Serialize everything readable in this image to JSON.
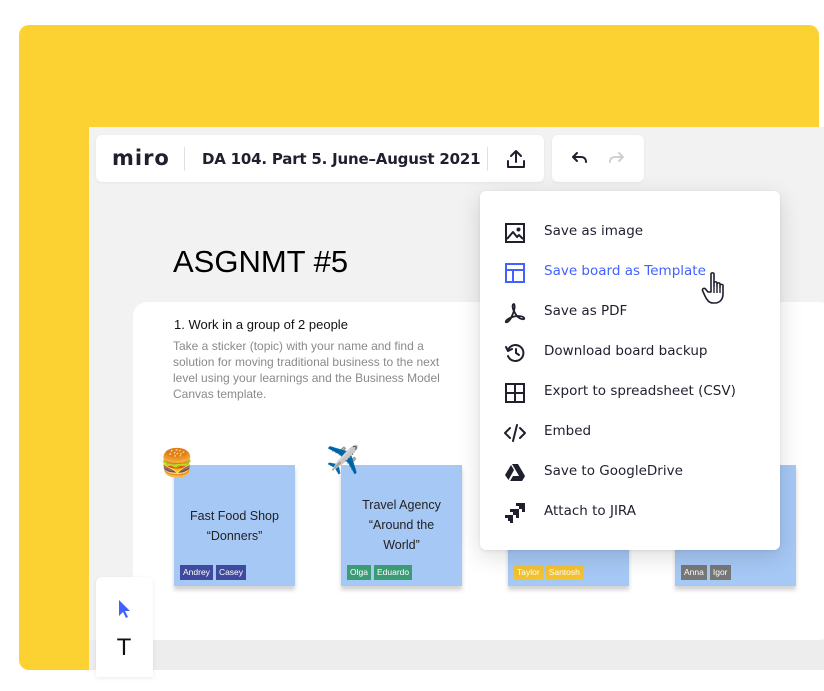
{
  "colors": {
    "background_accent": "#FCD232",
    "active_item": "#4262FF",
    "sticky": "#A6C8F5"
  },
  "toolbar": {
    "logo": "miro",
    "board_title": "DA 104. Part 5. June–August 2021",
    "export_icon": "upload-icon",
    "undo_icon": "undo-icon",
    "redo_icon": "redo-icon"
  },
  "board": {
    "heading": "ASGNMT #5",
    "task_title": "1. Work in a group of 2 people",
    "task_description": "Take a sticker (topic) with your name and find a solution for moving traditional business to the next level using your learnings and the Business Model Canvas template."
  },
  "stickies": [
    {
      "line1": "Fast Food Shop",
      "line2": "“Donners”",
      "line3": "",
      "tags": [
        {
          "name": "Andrey",
          "color": "#3F4A9E"
        },
        {
          "name": "Casey",
          "color": "#3F4A9E"
        }
      ],
      "emoji": "🍔"
    },
    {
      "line1": "Travel Agency",
      "line2": "“Around the",
      "line3": "World”",
      "tags": [
        {
          "name": "Olga",
          "color": "#3B9B74"
        },
        {
          "name": "Eduardo",
          "color": "#3B9B74"
        }
      ],
      "emoji": "✈️"
    },
    {
      "line1": "",
      "line2": "",
      "line3": "",
      "tags": [
        {
          "name": "Taylor",
          "color": "#F2C230"
        },
        {
          "name": "Santosh",
          "color": "#F2C230"
        }
      ],
      "emoji": ""
    },
    {
      "line1": "",
      "line2": "",
      "line3": "",
      "tags": [
        {
          "name": "Anna",
          "color": "#777777"
        },
        {
          "name": "Igor",
          "color": "#777777"
        }
      ],
      "emoji": ""
    }
  ],
  "export_menu": {
    "items": [
      {
        "label": "Save as image",
        "icon": "image-icon"
      },
      {
        "label": "Save board as Template",
        "icon": "template-icon",
        "active": true
      },
      {
        "label": "Save as PDF",
        "icon": "pdf-icon"
      },
      {
        "label": "Download board backup",
        "icon": "backup-icon"
      },
      {
        "label": "Export to spreadsheet (CSV)",
        "icon": "spreadsheet-icon"
      },
      {
        "label": "Embed",
        "icon": "code-icon"
      },
      {
        "label": "Save to GoogleDrive",
        "icon": "google-drive-icon"
      },
      {
        "label": "Attach to JIRA",
        "icon": "jira-icon"
      }
    ]
  },
  "tools": {
    "select_icon": "cursor-icon",
    "text_tool": "T"
  }
}
